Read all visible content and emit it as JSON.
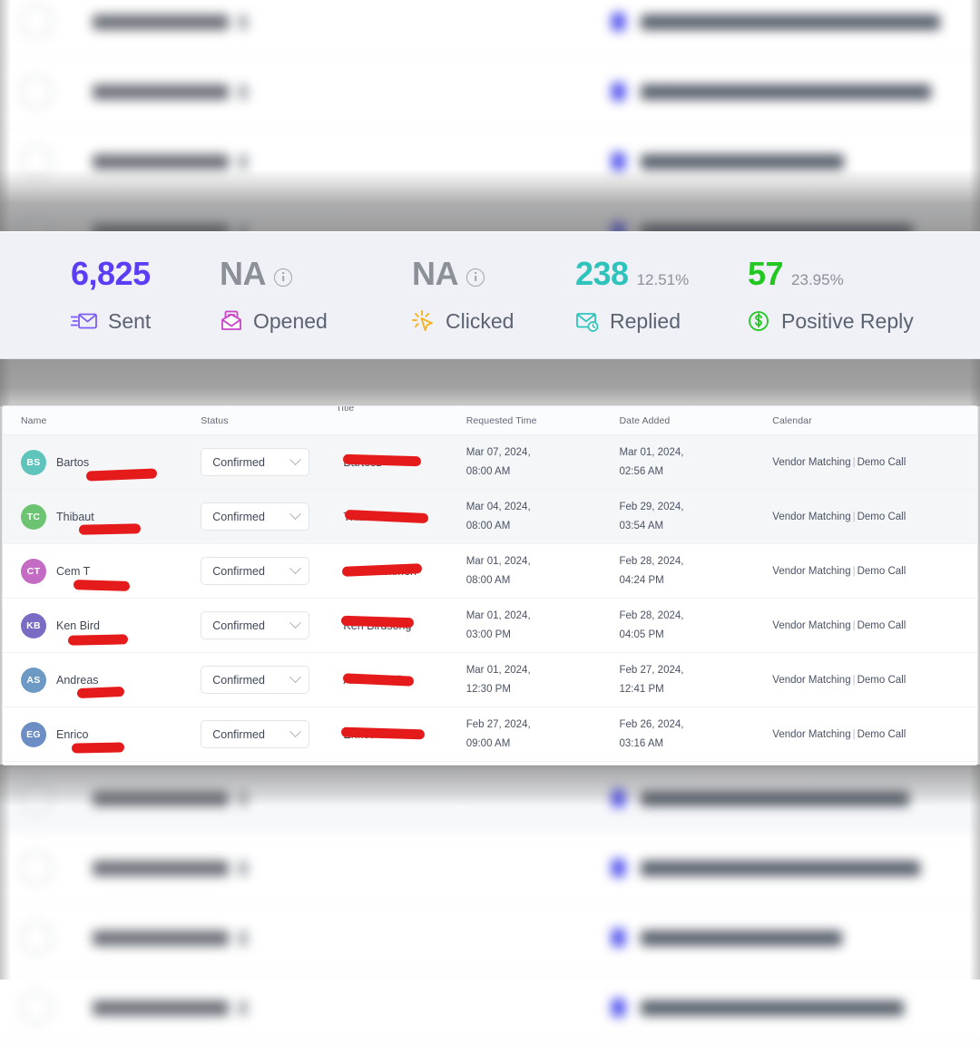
{
  "metrics": {
    "items": [
      {
        "value": "6,825",
        "pct": "",
        "label": "Sent",
        "icon": "envelope-send-icon",
        "color": "#5b3df5",
        "has_info": false
      },
      {
        "value": "NA",
        "pct": "",
        "label": "Opened",
        "icon": "envelope-open-icon",
        "color": "#8b9099",
        "has_info": true
      },
      {
        "value": "NA",
        "pct": "",
        "label": "Clicked",
        "icon": "cursor-click-icon",
        "color": "#8b9099",
        "has_info": true
      },
      {
        "value": "238",
        "pct": "12.51%",
        "label": "Replied",
        "icon": "envelope-reply-icon",
        "color": "#2ec4bc",
        "has_info": false
      },
      {
        "value": "57",
        "pct": "23.95%",
        "label": "Positive Reply",
        "icon": "dollar-circle-icon",
        "color": "#22c722",
        "has_info": false
      }
    ]
  },
  "table": {
    "columns": [
      "Name",
      "Status",
      "Title",
      "Requested Time",
      "Date Added",
      "Calendar"
    ],
    "status_selected": "Confirmed",
    "calendar_primary": "Vendor Matching",
    "calendar_secondary": "Demo Call",
    "rows": [
      {
        "initials": "BS",
        "avatar_color": "#5ec4bc",
        "name": "Bartos",
        "status": "Confirmed",
        "title": "Bartosz",
        "requested_date": "Mar 07, 2024,",
        "requested_time": "08:00 AM",
        "added_date": "Mar 01, 2024,",
        "added_time": "02:56 AM",
        "calendar": "Vendor Matching | Demo Call"
      },
      {
        "initials": "TC",
        "avatar_color": "#6cc472",
        "name": "Thibaut",
        "status": "Confirmed",
        "title": "Thibaut",
        "requested_date": "Mar 04, 2024,",
        "requested_time": "08:00 AM",
        "added_date": "Feb 29, 2024,",
        "added_time": "03:54 AM",
        "calendar": "Vendor Matching | Demo Call"
      },
      {
        "initials": "CT",
        "avatar_color": "#c46cc4",
        "name": "Cem T",
        "status": "Confirmed",
        "title": "Cem Tuskmen",
        "requested_date": "Mar 01, 2024,",
        "requested_time": "08:00 AM",
        "added_date": "Feb 28, 2024,",
        "added_time": "04:24 PM",
        "calendar": "Vendor Matching | Demo Call"
      },
      {
        "initials": "KB",
        "avatar_color": "#7a6cc4",
        "name": "Ken Bird",
        "status": "Confirmed",
        "title": "Ken Birdsong",
        "requested_date": "Mar 01, 2024,",
        "requested_time": "03:00 PM",
        "added_date": "Feb 28, 2024,",
        "added_time": "04:05 PM",
        "calendar": "Vendor Matching | Demo Call"
      },
      {
        "initials": "AS",
        "avatar_color": "#6c9ac4",
        "name": "Andreas",
        "status": "Confirmed",
        "title": "Andreas Sil",
        "requested_date": "Mar 01, 2024,",
        "requested_time": "12:30 PM",
        "added_date": "Feb 27, 2024,",
        "added_time": "12:41 PM",
        "calendar": "Vendor Matching | Demo Call"
      },
      {
        "initials": "EG",
        "avatar_color": "#6c8ec4",
        "name": "Enrico",
        "status": "Confirmed",
        "title": "Enrico Granelli",
        "requested_date": "Feb 27, 2024,",
        "requested_time": "09:00 AM",
        "added_date": "Feb 26, 2024,",
        "added_time": "03:16 AM",
        "calendar": "Vendor Matching | Demo Call"
      }
    ]
  }
}
